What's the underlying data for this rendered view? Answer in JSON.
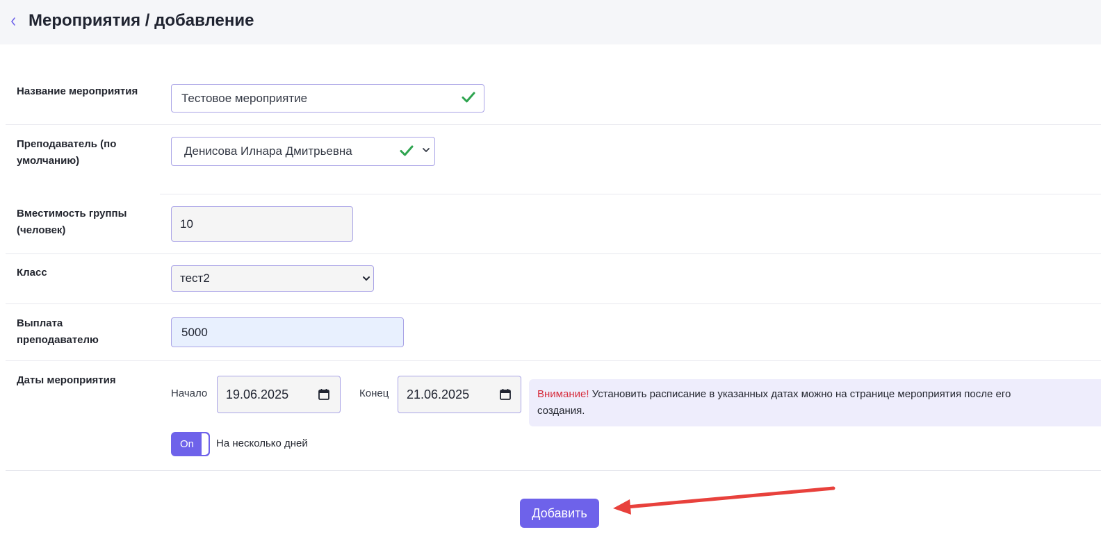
{
  "header": {
    "title": "Мероприятия / добавление",
    "back_icon": "chevron-left-icon"
  },
  "form": {
    "event_name": {
      "label": "Название мероприятия",
      "value": "Тестовое мероприятие"
    },
    "teacher": {
      "label_line1": "Преподаватель (по",
      "label_line2": "умолчанию)",
      "value": "Денисова Илнара Дмитрьевна"
    },
    "capacity": {
      "label_line1": "Вместимость группы",
      "label_line2": "(человек)",
      "value": "10"
    },
    "class": {
      "label": "Класс",
      "value": "тест2"
    },
    "payment": {
      "label_line1": "Выплата",
      "label_line2": "преподавателю",
      "value": "5000"
    },
    "dates": {
      "label": "Даты мероприятия",
      "start_label": "Начало",
      "start_value": "19.06.2025",
      "end_label": "Конец",
      "end_value": "21.06.2025",
      "alert_warning": "Внимание!",
      "alert_text_line1": " Установить расписание в указанных датах можно на странице мероприятия после его",
      "alert_text_line2": "создания.",
      "toggle_label": "On",
      "toggle_caption": "На несколько дней",
      "multi_day": true
    }
  },
  "submit_label": "Добавить",
  "colors": {
    "accent": "#6e62ea",
    "success": "#2ea44f",
    "warning": "#d62d3d",
    "alert_bg": "#eeedfc",
    "arrow": "#e8413c"
  }
}
